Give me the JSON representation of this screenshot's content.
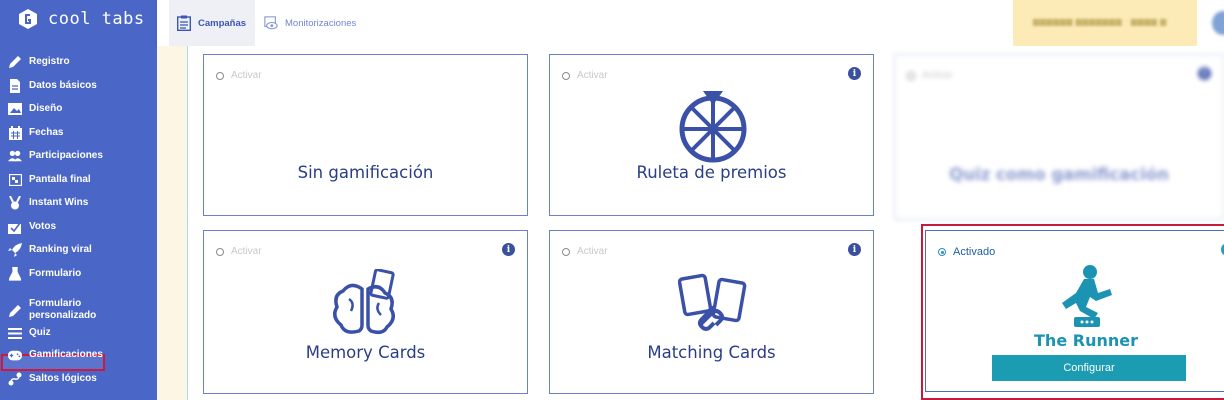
{
  "app": {
    "brand": "cool tabs"
  },
  "sidebar": {
    "items": [
      {
        "label": "Registro",
        "icon": "pencil-icon"
      },
      {
        "label": "Datos básicos",
        "icon": "document-icon"
      },
      {
        "label": "Diseño",
        "icon": "image-icon"
      },
      {
        "label": "Fechas",
        "icon": "calendar-icon"
      },
      {
        "label": "Participaciones",
        "icon": "users-icon"
      },
      {
        "label": "Pantalla final",
        "icon": "flag-icon"
      },
      {
        "label": "Instant Wins",
        "icon": "medal-icon"
      },
      {
        "label": "Votos",
        "icon": "vote-icon"
      },
      {
        "label": "Ranking viral",
        "icon": "rocket-icon"
      },
      {
        "label": "Formulario",
        "icon": "flask-icon"
      },
      {
        "label": "Formulario personalizado",
        "icon": "pen-icon"
      },
      {
        "label": "Quiz",
        "icon": "list-icon"
      },
      {
        "label": "Gamificaciones",
        "icon": "gamepad-icon"
      },
      {
        "label": "Saltos lógicos",
        "icon": "route-icon"
      }
    ],
    "active_index": 12
  },
  "topbar": {
    "tabs": [
      {
        "label": "Campañas",
        "icon": "clipboard-icon",
        "active": true
      },
      {
        "label": "Monitorizaciones",
        "icon": "eye-icon",
        "active": false
      }
    ]
  },
  "cards": {
    "none": {
      "radio_label": "Activar",
      "title": "Sin gamificación"
    },
    "roulette": {
      "radio_label": "Activar",
      "title": "Ruleta de premios"
    },
    "quiz": {
      "radio_label": "Activar",
      "title": "Quiz como gamificación"
    },
    "memory": {
      "radio_label": "Activar",
      "title": "Memory Cards"
    },
    "matching": {
      "radio_label": "Activar",
      "title": "Matching Cards"
    },
    "runner": {
      "radio_label": "Activado",
      "title": "The Runner",
      "button": "Configurar"
    }
  },
  "colors": {
    "sidebar_bg": "#4a66c6",
    "accent_teal": "#1b9cb3",
    "highlight_red": "#c51b3e",
    "title_navy": "#2a3e86"
  }
}
